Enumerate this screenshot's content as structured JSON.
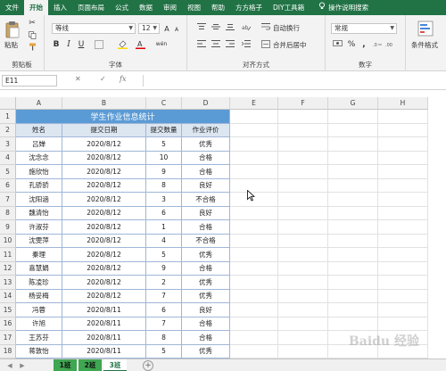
{
  "ribbon_tabs": [
    "文件",
    "开始",
    "插入",
    "页面布局",
    "公式",
    "数据",
    "审阅",
    "视图",
    "帮助",
    "方方格子",
    "DIY工具箱"
  ],
  "active_tab": "开始",
  "help_search": "操作说明搜索",
  "clipboard": {
    "paste_label": "粘贴",
    "group_label": "剪贴板"
  },
  "font_group": {
    "font_name": "等线",
    "font_size": "12",
    "group_label": "字体",
    "bold": "B",
    "italic": "I",
    "underline": "U",
    "grow": "A",
    "shrink": "A",
    "wen": "wén"
  },
  "alignment_group": {
    "wrap_label": "自动换行",
    "merge_label": "合并后居中",
    "group_label": "对齐方式"
  },
  "number_group": {
    "format": "常规",
    "percent": "%",
    "comma": ",",
    "group_label": "数字"
  },
  "styles_group": {
    "conditional_label": "条件格式"
  },
  "formula_bar": {
    "name_box": "E11",
    "fx": "fx",
    "cancel": "✕",
    "confirm": "✓"
  },
  "columns": [
    "A",
    "B",
    "C",
    "D",
    "E",
    "F",
    "G",
    "H"
  ],
  "table": {
    "title": "学生作业信息统计",
    "headers": [
      "姓名",
      "提交日期",
      "提交数量",
      "作业评价"
    ],
    "rows": [
      [
        "吕婵",
        "2020/8/12",
        "5",
        "优秀"
      ],
      [
        "沈念念",
        "2020/8/12",
        "10",
        "合格"
      ],
      [
        "施欣怡",
        "2020/8/12",
        "9",
        "合格"
      ],
      [
        "孔骄骄",
        "2020/8/12",
        "8",
        "良好"
      ],
      [
        "沈阳涵",
        "2020/8/12",
        "3",
        "不合格"
      ],
      [
        "魏清怡",
        "2020/8/12",
        "6",
        "良好"
      ],
      [
        "许淑芬",
        "2020/8/12",
        "1",
        "合格"
      ],
      [
        "沈雯萍",
        "2020/8/12",
        "4",
        "不合格"
      ],
      [
        "秦理",
        "2020/8/12",
        "5",
        "优秀"
      ],
      [
        "喜慧娟",
        "2020/8/12",
        "9",
        "合格"
      ],
      [
        "陈凌珍",
        "2020/8/12",
        "2",
        "优秀"
      ],
      [
        "杨妥梅",
        "2020/8/12",
        "7",
        "优秀"
      ],
      [
        "冯蓉",
        "2020/8/11",
        "6",
        "良好"
      ],
      [
        "许旭",
        "2020/8/11",
        "7",
        "合格"
      ],
      [
        "王苏芬",
        "2020/8/11",
        "8",
        "合格"
      ],
      [
        "蒋敦怡",
        "2020/8/11",
        "5",
        "优秀"
      ]
    ]
  },
  "row_numbers": [
    "1",
    "2",
    "3",
    "4",
    "5",
    "6",
    "7",
    "8",
    "9",
    "10",
    "11",
    "12",
    "13",
    "14",
    "15",
    "16",
    "17",
    "18"
  ],
  "sheet_tabs": [
    "1班",
    "2班",
    "3班"
  ],
  "add_sheet": "+",
  "watermark": "Baidu 经验"
}
